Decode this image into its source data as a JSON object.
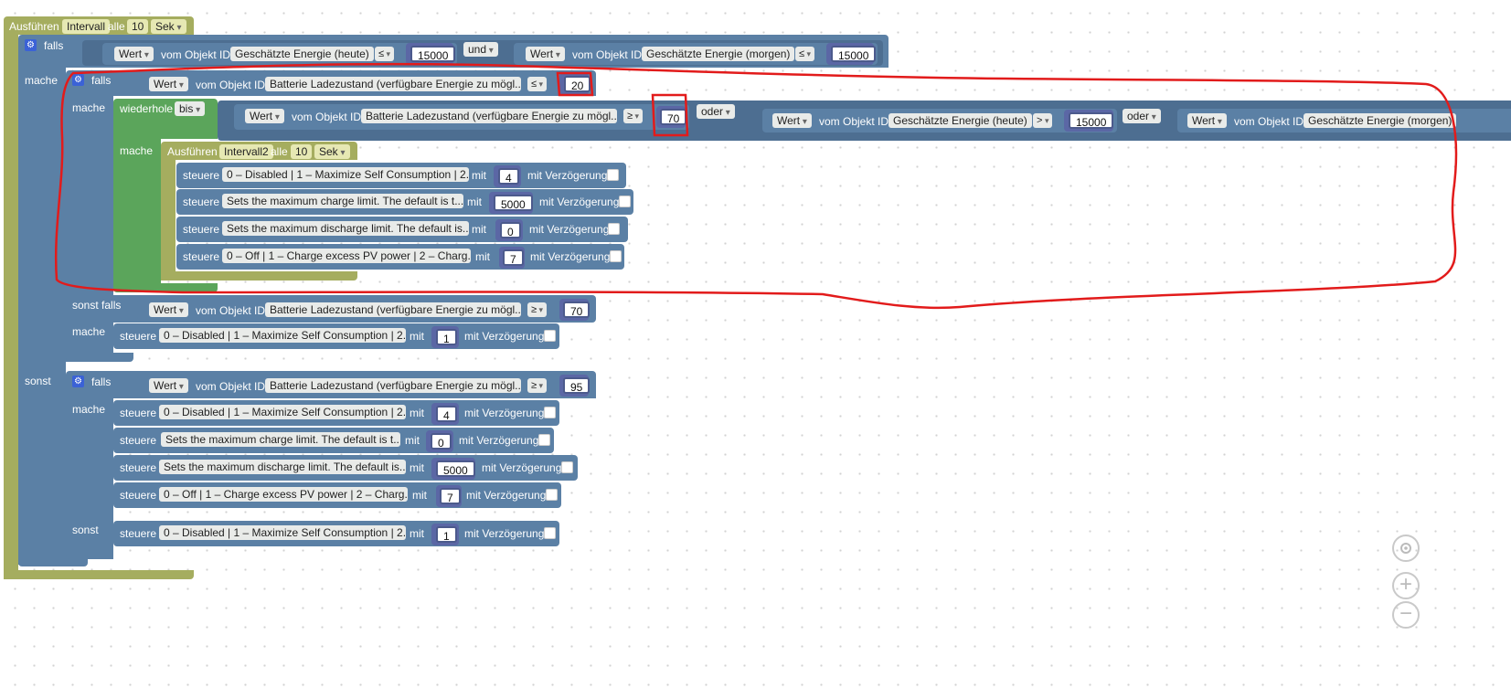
{
  "outer": {
    "title": "Ausführen",
    "name": "Intervall",
    "every": "alle",
    "interval": "10",
    "unit": "Sek"
  },
  "labels": {
    "falls": "falls",
    "mache": "mache",
    "sonst_falls": "sonst falls",
    "sonst": "sonst",
    "wiederhole": "wiederhole",
    "bis": "bis",
    "steuere": "steuere",
    "mit": "mit",
    "delay": "mit Verzögerung",
    "wert": "Wert",
    "vom": "vom Objekt ID",
    "und": "und",
    "oder": "oder"
  },
  "objects": {
    "energie_heute": "Geschätzte Energie (heute)",
    "energie_morgen": "Geschätzte Energie (morgen)",
    "batterie": "Batterie Ladezustand (verfügbare Energie zu mögl...",
    "batterie_long": "Batterie Ladezustand (verfügbare Energie zu mögl...",
    "mode": "0 – Disabled | 1 – Maximize Self Consumption | 2...",
    "charge": "Sets the maximum charge limit. The default is t...",
    "discharge": "Sets the maximum discharge limit. The default is...",
    "pv": "0 – Off | 1 – Charge excess PV power | 2 – Charg..."
  },
  "ops": {
    "le": "≤",
    "ge": "≥",
    "gt": ">"
  },
  "values": {
    "v15000": "15000",
    "v20": "20",
    "v70": "70",
    "v95": "95",
    "v4": "4",
    "v5000": "5000",
    "v0": "0",
    "v7": "7",
    "v1": "1"
  },
  "inner": {
    "title": "Ausführen",
    "name": "Intervall2",
    "every": "alle",
    "interval": "10",
    "unit": "Sek"
  },
  "icons": [
    "gear-icon",
    "target-icon",
    "zoom-in-icon",
    "zoom-out-icon"
  ]
}
